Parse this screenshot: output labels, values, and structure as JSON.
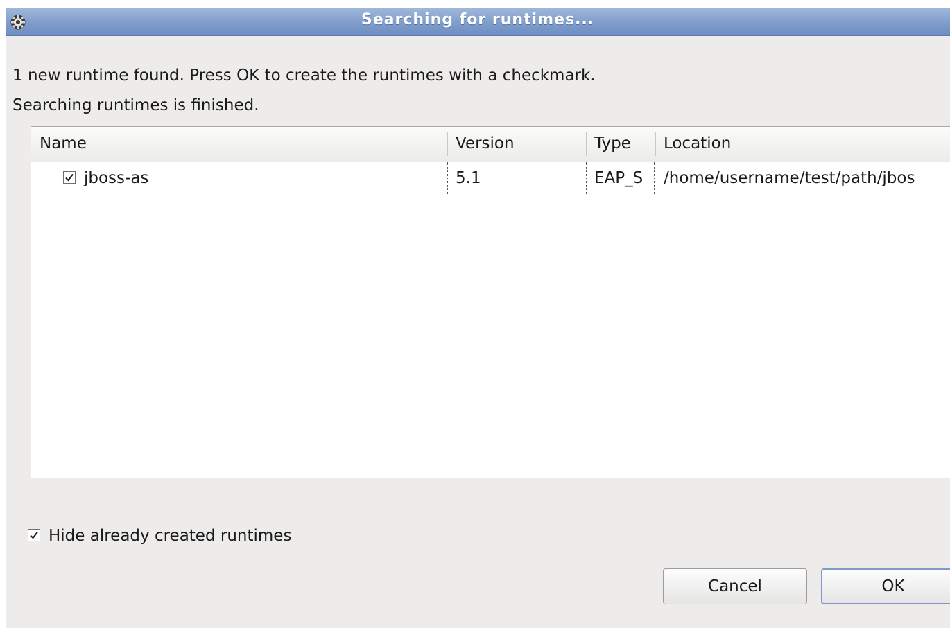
{
  "window": {
    "title": "Searching for runtimes...",
    "icon": "gear-icon"
  },
  "messages": {
    "found": "1 new runtime found. Press OK to create the runtimes with a checkmark.",
    "status": "Searching runtimes is finished."
  },
  "table": {
    "columns": [
      "Name",
      "Version",
      "Type",
      "Location"
    ],
    "rows": [
      {
        "checked": true,
        "name": "jboss-as",
        "version": "5.1",
        "type": "EAP_S",
        "location": "/home/username/test/path/jbos"
      }
    ]
  },
  "options": {
    "hide_created_label": "Hide already created runtimes",
    "hide_created_checked": true
  },
  "buttons": {
    "cancel": "Cancel",
    "ok": "OK"
  }
}
